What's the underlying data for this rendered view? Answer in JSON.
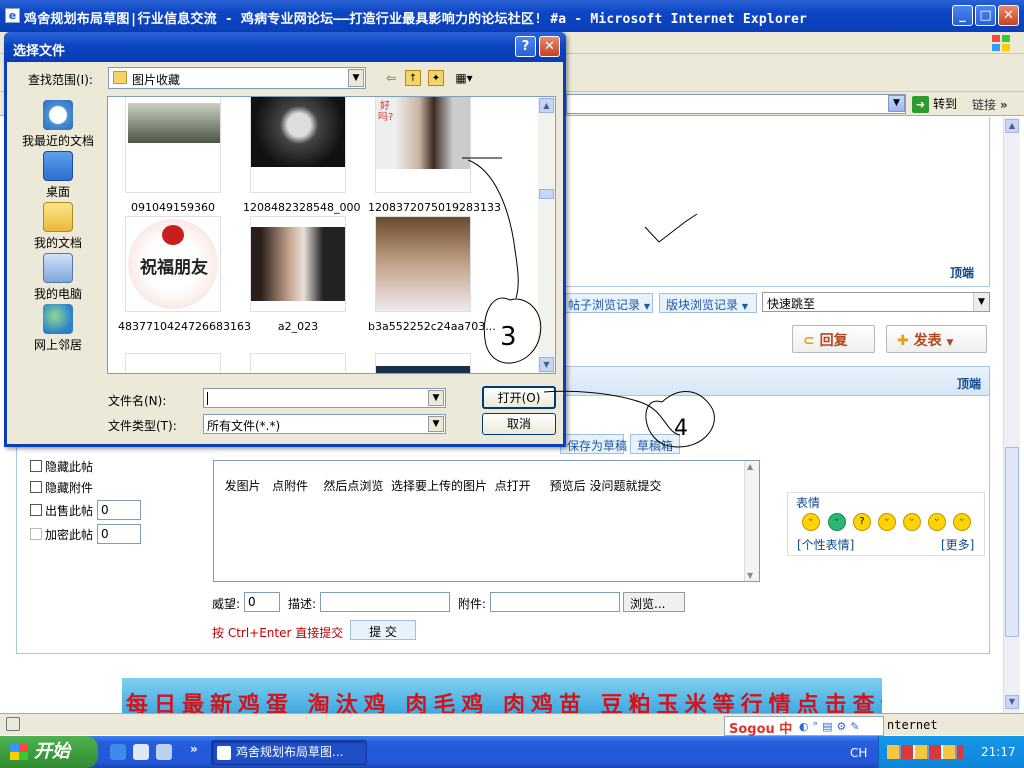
{
  "ie": {
    "title": "鸡舍规划布局草图|行业信息交流 - 鸡病专业网论坛——打造行业最具影响力的论坛社区! #a - Microsoft Internet Explorer",
    "go_label": "转到",
    "links_label": "链接",
    "status_zone": "nternet"
  },
  "forum": {
    "top_label_1": "顶端",
    "top_label_2": "顶端",
    "nav_post_history": "帖子浏览记录",
    "nav_board_history": "版块浏览记录",
    "quick_jump": "快速跳至",
    "reply_btn": "回复",
    "new_post_btn": "发表",
    "save_draft": "保存为草稿",
    "draft_box": "草稿箱",
    "options": [
      {
        "label": "隐藏此帖",
        "value": ""
      },
      {
        "label": "隐藏附件",
        "value": ""
      },
      {
        "label": "出售此帖",
        "value": "0"
      },
      {
        "label": "加密此帖",
        "value": "0"
      }
    ],
    "message_text": "发图片   点附件    然后点浏览  选择要上传的图片  点打开     预览后 没问题就提交",
    "emoji_title": "表情",
    "emoji_personal": "[个性表情]",
    "emoji_more": "[更多]",
    "prestige_label": "威望:",
    "prestige_value": "0",
    "desc_label": "描述:",
    "attach_label": "附件:",
    "browse_btn": "浏览...",
    "ctrl_enter_hint": "按 Ctrl+Enter 直接提交",
    "submit_btn": "提 交",
    "banner_text": "每日最新鸡蛋 淘汰鸡 肉毛鸡 肉鸡苗 豆粕玉米等行情点击查询"
  },
  "dialog": {
    "title": "选择文件",
    "look_in_label": "查找范围(I):",
    "look_in_value": "图片收藏",
    "places": [
      "我最近的文档",
      "桌面",
      "我的文档",
      "我的电脑",
      "网上邻居"
    ],
    "files": [
      "091049159360",
      "1208482328548_000",
      "1208372075019283133",
      "4837710424726683163",
      "a2_023",
      "b3a552252c24aa703..."
    ],
    "thumb_text_1": "祝福朋友",
    "thumb_text_2": "好吗?",
    "filename_label": "文件名(N):",
    "filename_value": "",
    "filetype_label": "文件类型(T):",
    "filetype_value": "所有文件(*.*)",
    "open_btn": "打开(O)",
    "cancel_btn": "取消"
  },
  "sogou": {
    "text": "Sogou 中"
  },
  "taskbar": {
    "start_label": "开始",
    "task_label": "鸡舍规划布局草图...",
    "lang": "CH",
    "clock": "21:17"
  },
  "annotations": [
    "3",
    "4"
  ],
  "colors": {
    "xp_blue": "#0a3fb8",
    "taskbar": "#245ddb",
    "start_green": "#318b31",
    "reply_red": "#b5461b",
    "hint_red": "#c00000"
  }
}
